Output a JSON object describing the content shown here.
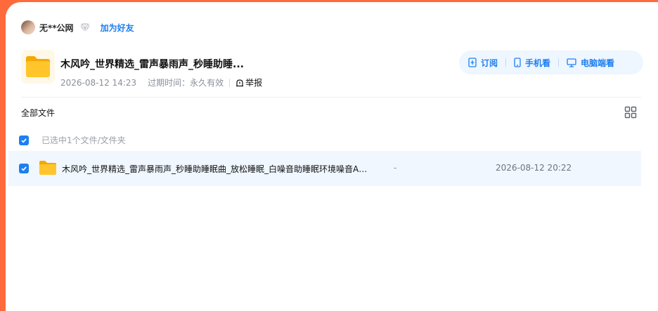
{
  "user": {
    "name": "无**公网",
    "add_friend": "加为好友"
  },
  "share": {
    "title": "木风吟_世界精选_雷声暴雨声_秒睡助睡...",
    "date": "2026-08-12 14:23",
    "expire_label": "过期时间：",
    "expire_value": "永久有效",
    "report": "举报"
  },
  "actions": {
    "subscribe": "订阅",
    "phone": "手机看",
    "pc": "电脑端看"
  },
  "breadcrumb": "全部文件",
  "selection": {
    "text": "已选中1个文件/文件夹"
  },
  "files": [
    {
      "name": "木风吟_世界精选_雷声暴雨声_秒睡助睡眠曲_放松睡眠_白噪音助睡眠环境噪音ASMR",
      "size": "-",
      "date": "2026-08-12 20:22",
      "checked": true
    }
  ],
  "colors": {
    "accent": "#1e7ff0",
    "frame": "#ff6a3d",
    "folder": "#ffc52b"
  },
  "icons": [
    "diamond-icon",
    "folder-icon",
    "report-icon",
    "subscribe-icon",
    "phone-icon",
    "monitor-icon",
    "grid-view-icon",
    "check-icon"
  ]
}
